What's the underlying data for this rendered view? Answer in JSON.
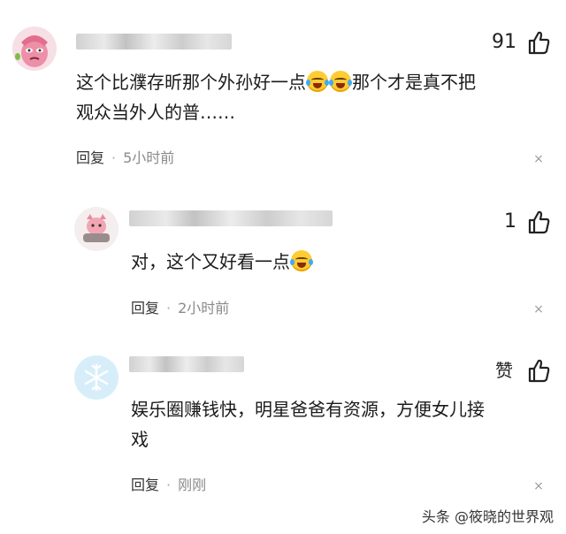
{
  "comments": [
    {
      "likes": "91",
      "text_a": "这个比濮存昕那个外孙好一点",
      "text_b": "那个才是真不把",
      "text_c": "观众当外人的普……",
      "reply_label": "回复",
      "time": "5小时前",
      "close": "×"
    },
    {
      "likes": "1",
      "text_a": "对，这个又好看一点",
      "reply_label": "回复",
      "time": "2小时前",
      "close": "×"
    },
    {
      "likes": "赞",
      "text_a": "娱乐圈赚钱快，明星爸爸有资源，方便女儿接",
      "text_b": "戏",
      "reply_label": "回复",
      "time": "刚刚",
      "close": "×"
    }
  ],
  "watermark": "头条 @筱晓的世界观",
  "icons": {
    "like": "thumbs-up-icon",
    "emoji": "laughing-tears-emoji",
    "close": "close-icon"
  },
  "colors": {
    "accent_blue": "#3fa9f5",
    "muted_text": "#8a8a8a"
  }
}
